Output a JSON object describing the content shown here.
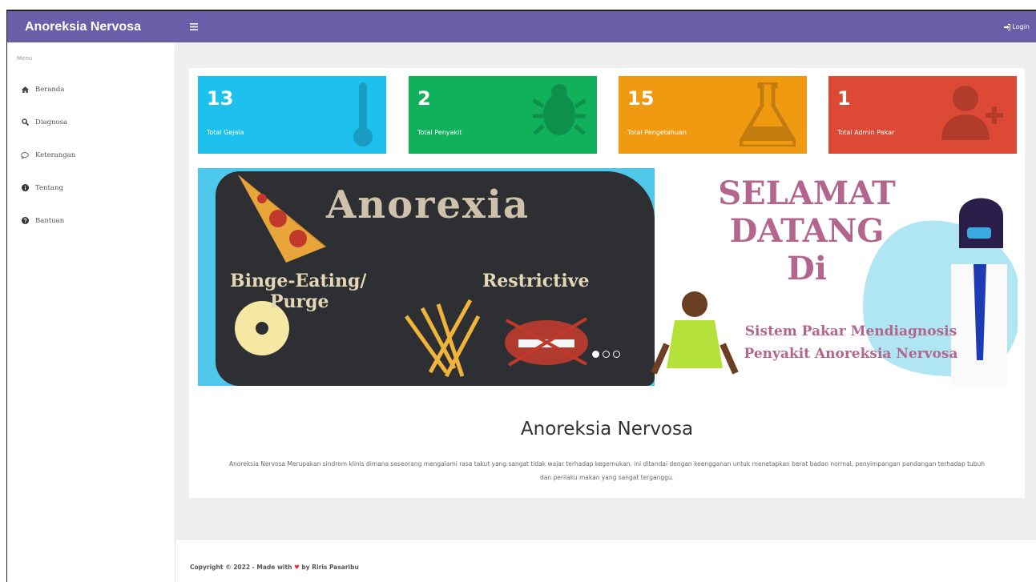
{
  "navbar": {
    "brand": "Anoreksia Nervosa",
    "login_label": "Login"
  },
  "sidebar": {
    "heading": "Menu",
    "items": [
      {
        "label": "Beranda",
        "icon": "home-icon"
      },
      {
        "label": "Diagnosa",
        "icon": "search-icon"
      },
      {
        "label": "Keterangan",
        "icon": "comment-icon"
      },
      {
        "label": "Tentang",
        "icon": "info-circle-icon"
      },
      {
        "label": "Bantuan",
        "icon": "question-circle-icon"
      }
    ]
  },
  "stats": [
    {
      "value": "13",
      "label": "Total Gejala",
      "color": "#1ec0ee",
      "icon": "thermometer-icon"
    },
    {
      "value": "2",
      "label": "Total Penyakit",
      "color": "#11b15c",
      "icon": "bug-icon"
    },
    {
      "value": "15",
      "label": "Total Pengetahuan",
      "color": "#f09a12",
      "icon": "flask-icon"
    },
    {
      "value": "1",
      "label": "Total Admin Pakar",
      "color": "#dc4935",
      "icon": "user-plus-icon"
    }
  ],
  "banner": {
    "left_title": "Anorexia",
    "left_sub1": "Binge-Eating/",
    "left_sub2": "Purge",
    "left_sub3": "Restrictive",
    "right_line1": "SELAMAT",
    "right_line2": "DATANG",
    "right_line3": "Di",
    "right_line4": "Sistem Pakar Mendiagnosis",
    "right_line5": "Penyakit Anoreksia Nervosa"
  },
  "main": {
    "title": "Anoreksia Nervosa",
    "description": "Anoreksia Nervosa Merupakan sindrom klinis dimana seseorang mengalami rasa takut yang sangat tidak wajar terhadap kegemukan. ini ditandai dengan keengganan untuk menetapkan berat badan normal, penyimpangan pandangan terhadap tubuh dan perilaku makan yang sangat terganggu."
  },
  "footer": {
    "prefix": "Copyright © 2022 - Made with",
    "suffix": "by Riris Pasaribu"
  }
}
